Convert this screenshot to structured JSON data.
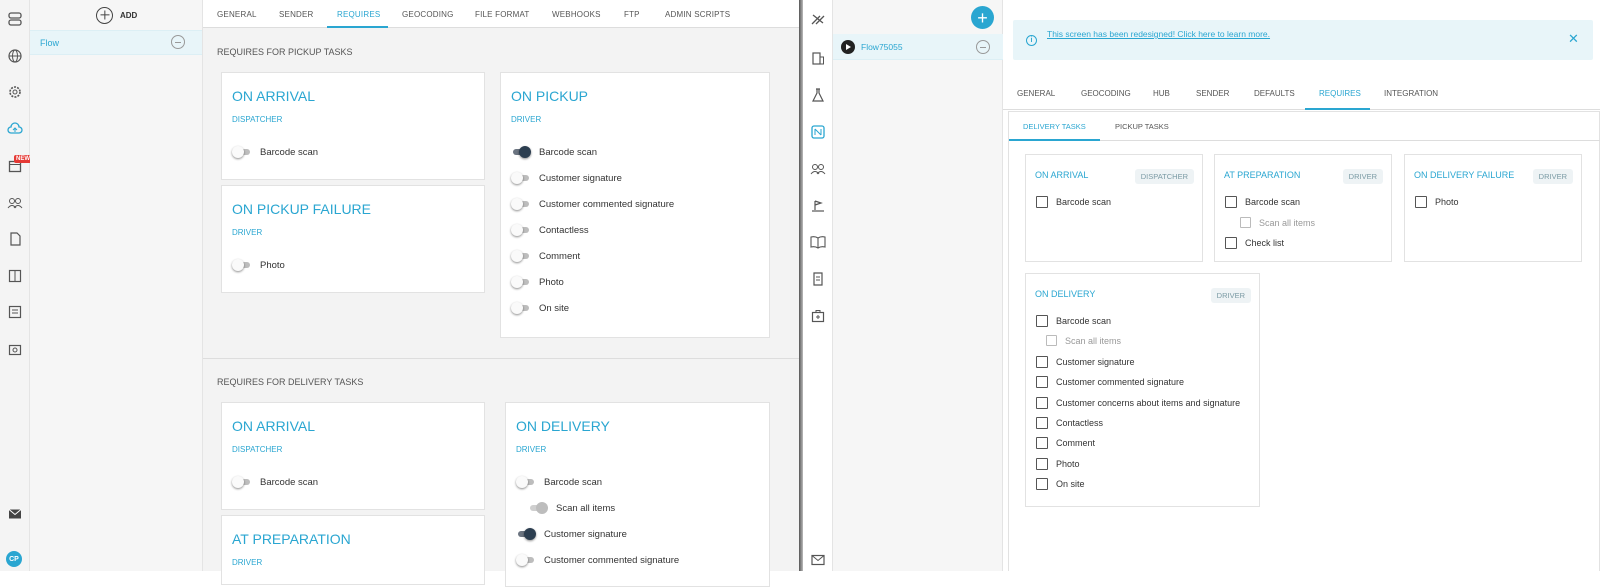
{
  "left": {
    "list": {
      "add_label": "ADD",
      "flow_label": "Flow"
    },
    "tabs": [
      "GENERAL",
      "SENDER",
      "REQUIRES",
      "GEOCODING",
      "FILE FORMAT",
      "WEBHOOKS",
      "FTP",
      "ADMIN SCRIPTS"
    ],
    "active_tab": "REQUIRES",
    "pickup": {
      "heading": "REQUIRES FOR PICKUP TASKS",
      "on_arrival": {
        "title": "ON ARRIVAL",
        "role": "DISPATCHER",
        "items": [
          {
            "label": "Barcode scan",
            "state": "off"
          }
        ]
      },
      "on_pickup_failure": {
        "title": "ON PICKUP FAILURE",
        "role": "DRIVER",
        "items": [
          {
            "label": "Photo",
            "state": "off"
          }
        ]
      },
      "on_pickup": {
        "title": "ON PICKUP",
        "role": "DRIVER",
        "items": [
          {
            "label": "Barcode scan",
            "state": "on"
          },
          {
            "label": "Customer signature",
            "state": "off"
          },
          {
            "label": "Customer commented signature",
            "state": "off"
          },
          {
            "label": "Contactless",
            "state": "off"
          },
          {
            "label": "Comment",
            "state": "off"
          },
          {
            "label": "Photo",
            "state": "off"
          },
          {
            "label": "On site",
            "state": "off"
          }
        ]
      }
    },
    "delivery": {
      "heading": "REQUIRES FOR DELIVERY TASKS",
      "on_arrival": {
        "title": "ON ARRIVAL",
        "role": "DISPATCHER",
        "items": [
          {
            "label": "Barcode scan",
            "state": "off"
          }
        ]
      },
      "at_preparation": {
        "title": "AT PREPARATION",
        "role": "DRIVER"
      },
      "on_delivery": {
        "title": "ON DELIVERY",
        "role": "DRIVER",
        "items": [
          {
            "label": "Barcode scan",
            "state": "off"
          },
          {
            "label": "Scan all items",
            "state": "disabled"
          },
          {
            "label": "Customer signature",
            "state": "on"
          },
          {
            "label": "Customer commented signature",
            "state": "off"
          }
        ]
      }
    },
    "rail_badge": "NEW",
    "avatar_initials": "CP"
  },
  "right": {
    "flow_label": "Flow75055",
    "banner": "This screen has been redesigned! Click here to learn more.",
    "tabs": [
      "GENERAL",
      "GEOCODING",
      "HUB",
      "SENDER",
      "DEFAULTS",
      "REQUIRES",
      "INTEGRATION"
    ],
    "active_tab": "REQUIRES",
    "subtabs": [
      "DELIVERY TASKS",
      "PICKUP TASKS"
    ],
    "active_subtab": "DELIVERY TASKS",
    "cards": {
      "on_arrival": {
        "title": "ON ARRIVAL",
        "role": "DISPATCHER",
        "items": [
          {
            "label": "Barcode scan"
          }
        ]
      },
      "at_preparation": {
        "title": "AT PREPARATION",
        "role": "DRIVER",
        "items": [
          {
            "label": "Barcode scan"
          },
          {
            "label": "Scan all items",
            "disabled": true
          },
          {
            "label": "Check list"
          }
        ]
      },
      "on_delivery_failure": {
        "title": "ON DELIVERY FAILURE",
        "role": "DRIVER",
        "items": [
          {
            "label": "Photo"
          }
        ]
      },
      "on_delivery": {
        "title": "ON DELIVERY",
        "role": "DRIVER",
        "items": [
          {
            "label": "Barcode scan"
          },
          {
            "label": "Scan all items",
            "disabled": true
          },
          {
            "label": "Customer signature"
          },
          {
            "label": "Customer commented signature"
          },
          {
            "label": "Customer concerns about items and signature"
          },
          {
            "label": "Contactless"
          },
          {
            "label": "Comment"
          },
          {
            "label": "Photo"
          },
          {
            "label": "On site"
          }
        ]
      }
    }
  },
  "colors": {
    "accent": "#2aa6d1",
    "toggle_on": "#2c3e50"
  }
}
